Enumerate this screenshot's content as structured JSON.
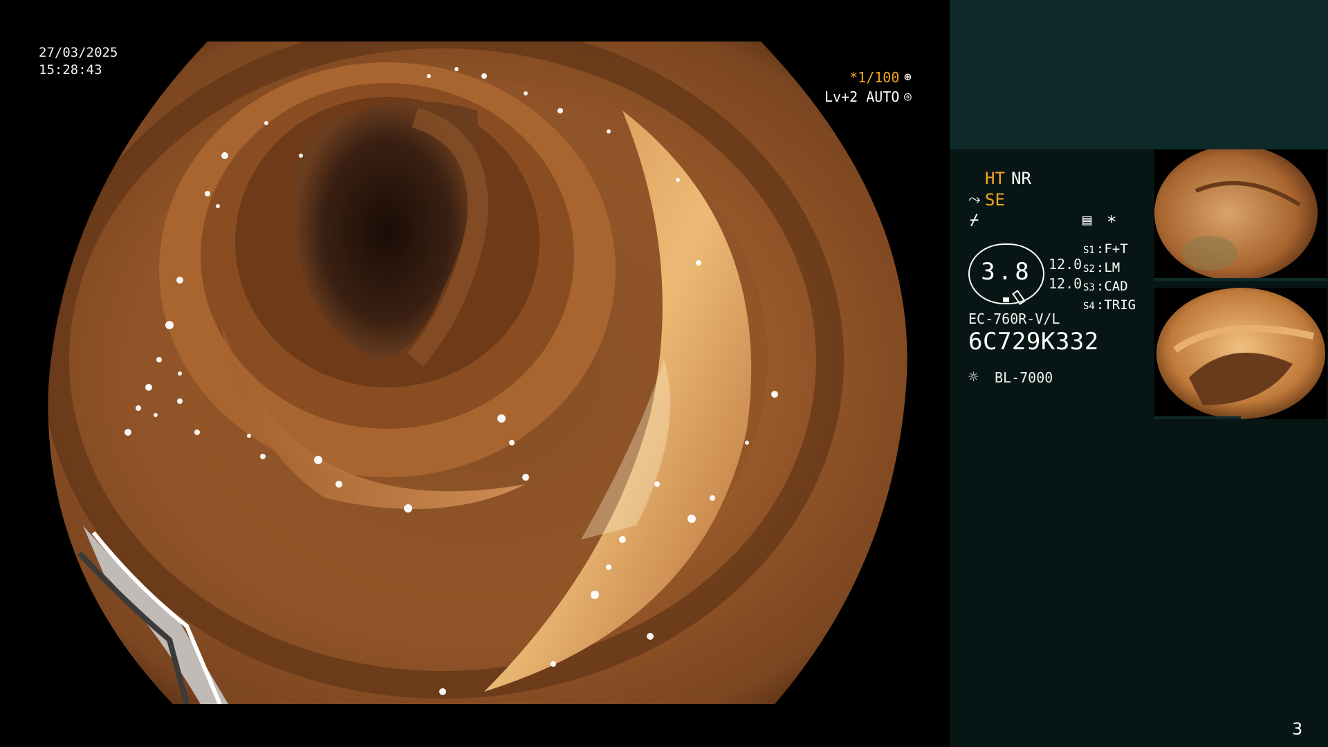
{
  "overlay": {
    "date": "27/03/2025",
    "time": "15:28:43",
    "shutter": "*1/100",
    "level": "Lv+2 AUTO"
  },
  "panel": {
    "ht": "HT",
    "nr": "NR",
    "se": "SE",
    "zoom": "3.8",
    "val_top": "12.0",
    "val_bottom": "12.0",
    "switches": [
      {
        "label": "S1",
        "value": "F+T"
      },
      {
        "label": "S2",
        "value": "LM"
      },
      {
        "label": "S3",
        "value": "CAD"
      },
      {
        "label": "S4",
        "value": "TRIG"
      }
    ],
    "scope_model": "EC-760R-V/L",
    "serial": "6C729K332",
    "light_source": "BL-7000",
    "asterisk": "*"
  },
  "page_number": "3",
  "colors": {
    "panel_bg": "#071614",
    "panel_top_bg": "#0e2a28",
    "accent_orange": "#f5a623"
  },
  "icons": [
    "shutter-dial-icon",
    "auto-iris-icon",
    "filter-icon",
    "enhance-icon",
    "memo-icon",
    "light-bulb-icon",
    "pen-icon"
  ]
}
